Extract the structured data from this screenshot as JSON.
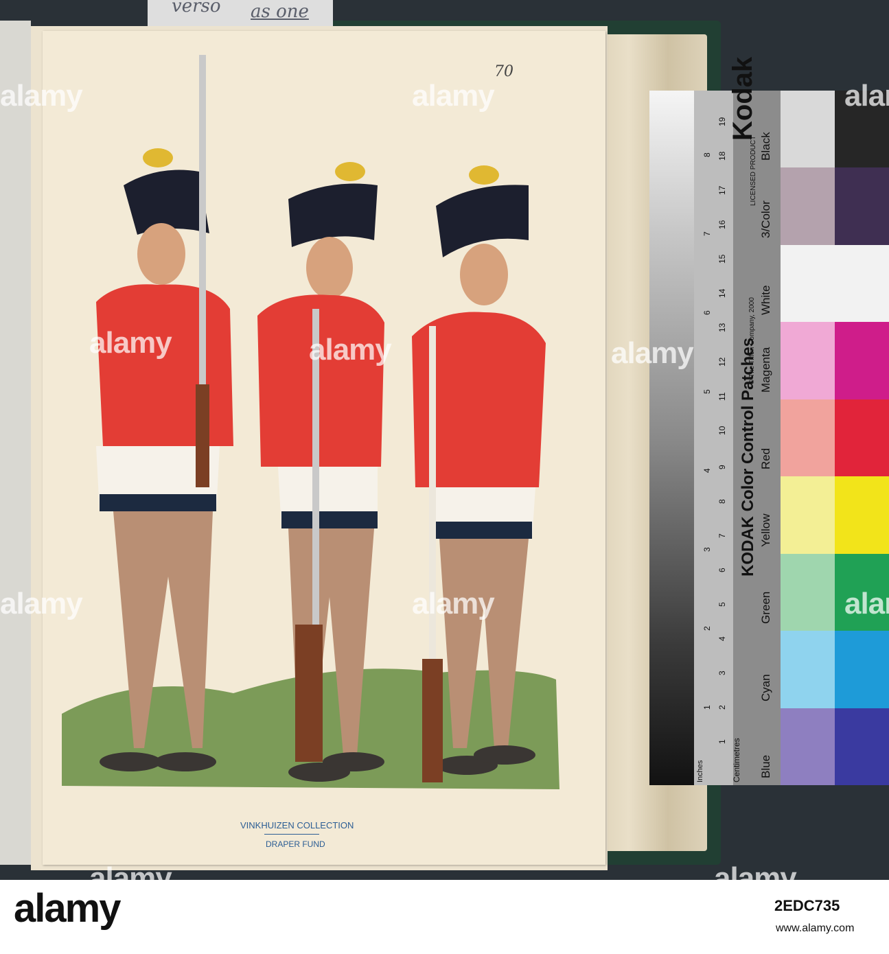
{
  "pencil_note": {
    "verso": "verso",
    "as_one": "as one"
  },
  "page_number": "70",
  "stamp": {
    "line1": "VINKHUIZEN COLLECTION",
    "line2": "DRAPER FUND"
  },
  "color_card": {
    "brand_vertical": "Kodak",
    "licensed": "LICENSED PRODUCT",
    "title": "KODAK Color Control Patches",
    "copyright": "© The Tiffen Company, 2000",
    "units_inches": "Inches",
    "units_cm": "Centimetres",
    "inch_ticks": [
      "1",
      "2",
      "3",
      "4",
      "5",
      "6",
      "7",
      "8"
    ],
    "cm_ticks": [
      "1",
      "2",
      "3",
      "4",
      "5",
      "6",
      "7",
      "8",
      "9",
      "10",
      "11",
      "12",
      "13",
      "14",
      "15",
      "16",
      "17",
      "18",
      "19"
    ],
    "patch_labels": [
      "Blue",
      "Cyan",
      "Green",
      "Yellow",
      "Red",
      "Magenta",
      "White",
      "3/Color",
      "Black"
    ],
    "patch_colors": [
      [
        "#8e7fc0",
        "#3a3aa0"
      ],
      [
        "#8fd3ee",
        "#1e9bd8"
      ],
      [
        "#9fd6ae",
        "#20a155"
      ],
      [
        "#f3ef95",
        "#f2e41a"
      ],
      [
        "#f1a39d",
        "#e1243a"
      ],
      [
        "#f0a9d5",
        "#cf1d8a"
      ],
      [
        "#f2f2f2",
        "#f2f2f2"
      ],
      [
        "#b4a2ad",
        "#3f2f52"
      ],
      [
        "#d9d9d9",
        "#262626"
      ]
    ]
  },
  "watermark": {
    "text": "alamy",
    "image_id": "2EDC735",
    "site": "www.alamy.com"
  },
  "colors": {
    "coat_red": "#e33d35",
    "hat_black": "#1c1f2e",
    "grass_green": "#7c9b58",
    "paper": "#f3ead6"
  }
}
